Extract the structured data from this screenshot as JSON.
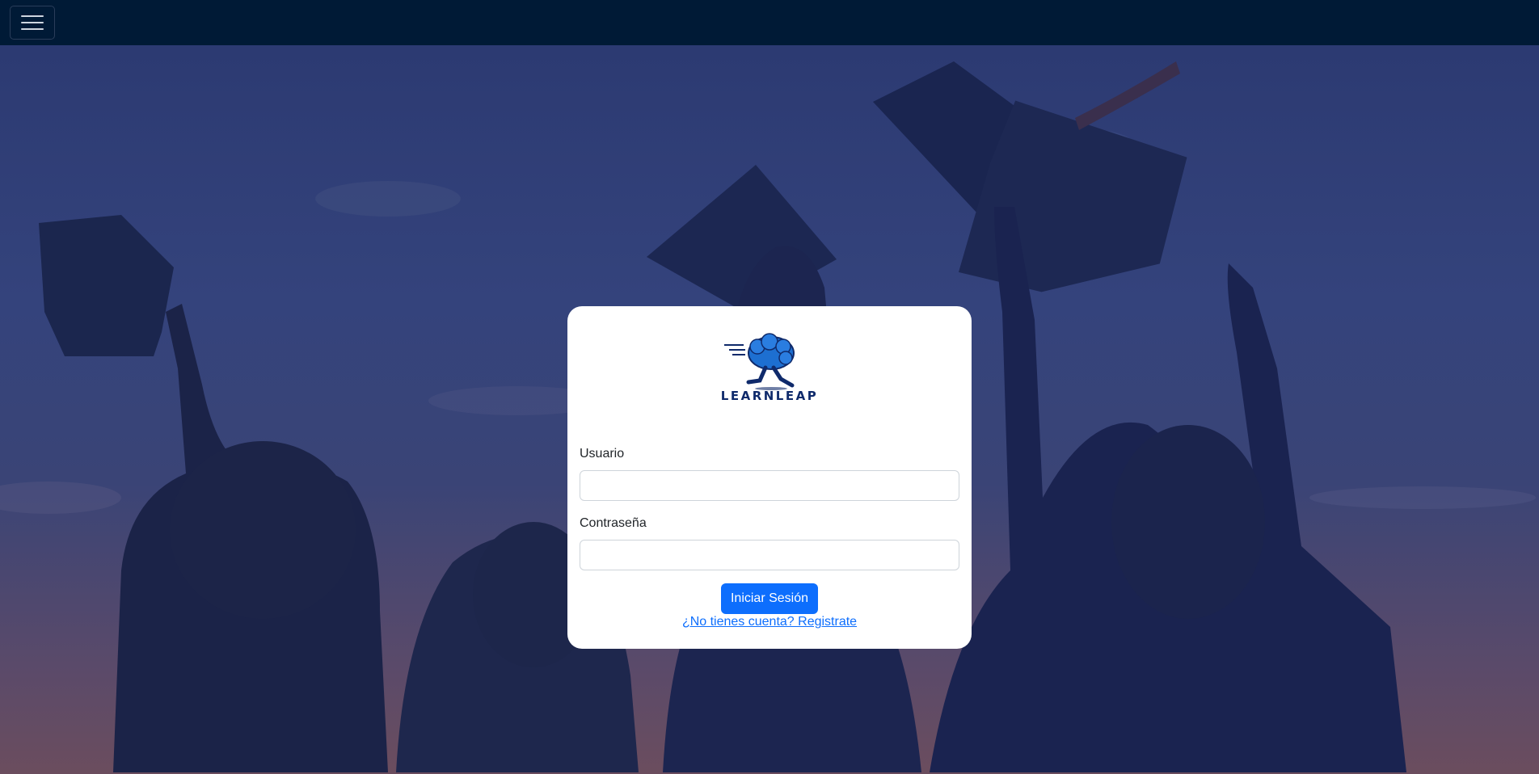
{
  "navbar": {
    "toggle_icon": "hamburger-menu-icon",
    "background": "#001a36"
  },
  "hero": {
    "image": "graduates-throwing-caps-silhouette"
  },
  "login": {
    "logo_icon": "running-brain-icon",
    "brand_name": "LEARNLEAP",
    "username_label": "Usuario",
    "username_value": "",
    "password_label": "Contraseña",
    "password_value": "",
    "submit_label": "Iniciar Sesión",
    "register_link": "¿No tienes cuenta? Registrate"
  },
  "colors": {
    "accent": "#0d6efd",
    "brand": "#0f2a6b"
  }
}
